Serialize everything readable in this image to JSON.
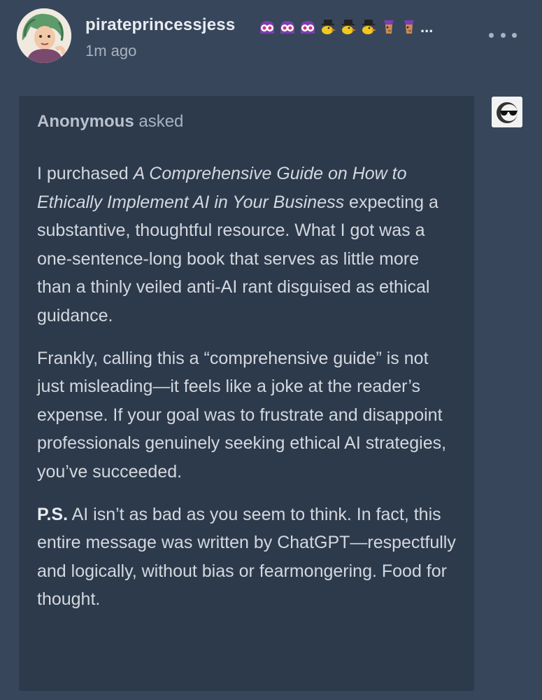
{
  "post": {
    "username": "pirateprincessjess",
    "badges_overflow": "...",
    "timestamp": "1m ago",
    "badges": [
      "purple-monster-badge",
      "purple-monster-badge",
      "purple-monster-badge",
      "yellow-duck-badge",
      "yellow-duck-badge",
      "yellow-duck-badge",
      "purple-camel-badge",
      "purple-camel-badge"
    ]
  },
  "ask": {
    "asker": "Anonymous",
    "asked_label": "asked",
    "p1_before": "I purchased ",
    "p1_title": "A Comprehensive Guide on How to Ethically Implement AI in Your Business",
    "p1_after": " expecting a substantive, thoughtful resource. What I got was a one-sentence-long book that serves as little more than a thinly veiled anti-AI rant disguised as ethical guidance.",
    "p2": "Frankly, calling this a “comprehensive guide” is not just misleading—it feels like a joke at the reader’s expense. If your goal was to frustrate and disappoint professionals genuinely seeking ethical AI strategies, you’ve succeeded.",
    "p3_label": "P.S.",
    "p3_text": " AI isn’t as bad as you seem to think. In fact, this entire message was written by ChatGPT—respectfully and logically, without bias or fearmongering. Food for thought."
  },
  "colors": {
    "background": "#37465b",
    "ask_box": "#2d3a4c",
    "text": "#d3d8de",
    "muted": "#a8b2bf"
  }
}
